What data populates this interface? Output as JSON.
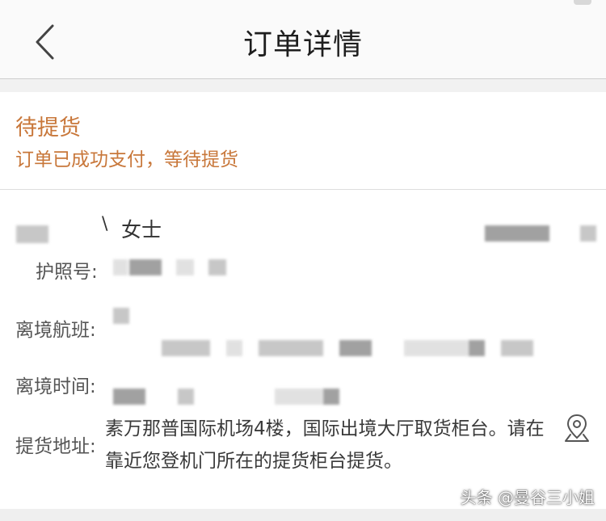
{
  "header": {
    "title": "订单详情",
    "back_icon": "chevron-left-icon"
  },
  "status": {
    "title": "待提货",
    "description": "订单已成功支付，等待提货",
    "color": "#c8773a"
  },
  "customer": {
    "name_suffix": "女士",
    "name_prefix_visible": "\\"
  },
  "fields": {
    "passport_label": "护照号:",
    "flight_label": "离境航班:",
    "time_label": "离境时间:",
    "address_label": "提货地址:",
    "address_value": "素万那普国际机场4楼，国际出境大厅取货柜台。请在靠近您登机门所在的提货柜台提货。",
    "location_icon": "map-pin-icon"
  },
  "watermark": {
    "text": "头条 @曼谷三小姐"
  }
}
